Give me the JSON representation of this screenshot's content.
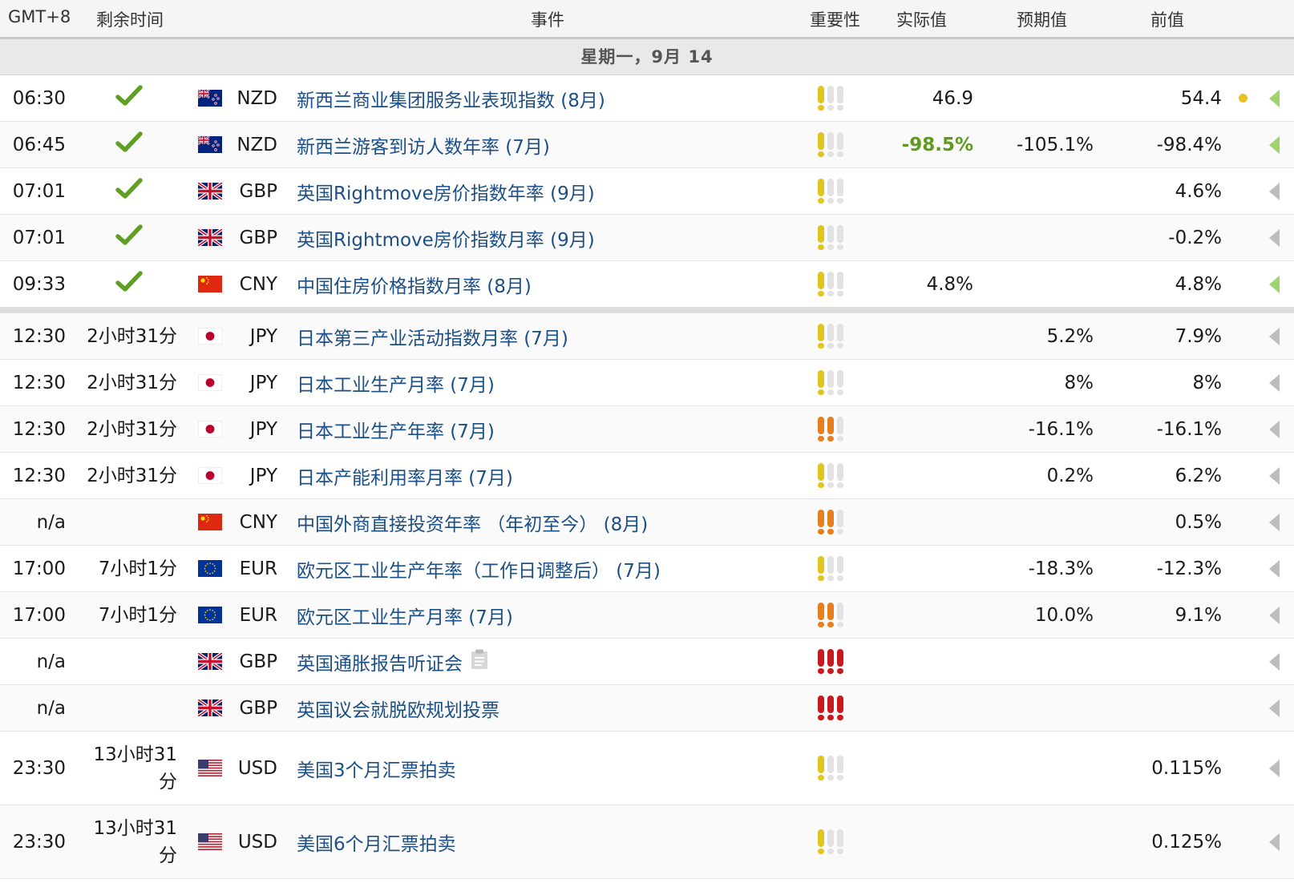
{
  "header": {
    "timezone": "GMT+8",
    "remaining": "剩余时间",
    "event": "事件",
    "importance": "重要性",
    "actual": "实际值",
    "forecast": "预期值",
    "previous": "前值"
  },
  "date_label": "星期一，9月 14",
  "colors": {
    "event_text": "#1c4f86",
    "actual_positive": "#5d9a1d",
    "check": "#5e9f24",
    "importance_low": "#e1c51c",
    "importance_medium": "#e87f1e",
    "importance_high": "#c8191f"
  },
  "rows": [
    {
      "time": "06:30",
      "done": true,
      "remaining": "",
      "flag": "nzd-flag",
      "currency": "NZD",
      "event": "新西兰商业集团服务业表现指数 (8月)",
      "importance": 1,
      "actual": "46.9",
      "actual_pos": false,
      "forecast": "",
      "previous": "54.4",
      "dot": true,
      "arrow": "green"
    },
    {
      "time": "06:45",
      "done": true,
      "remaining": "",
      "flag": "nzd-flag",
      "currency": "NZD",
      "event": "新西兰游客到访人数年率 (7月)",
      "importance": 1,
      "actual": "-98.5%",
      "actual_pos": true,
      "forecast": "-105.1%",
      "previous": "-98.4%",
      "dot": false,
      "arrow": "green"
    },
    {
      "time": "07:01",
      "done": true,
      "remaining": "",
      "flag": "gbp-flag",
      "currency": "GBP",
      "event": "英国Rightmove房价指数年率 (9月)",
      "importance": 1,
      "actual": "",
      "actual_pos": false,
      "forecast": "",
      "previous": "4.6%",
      "dot": false,
      "arrow": "gray"
    },
    {
      "time": "07:01",
      "done": true,
      "remaining": "",
      "flag": "gbp-flag",
      "currency": "GBP",
      "event": "英国Rightmove房价指数月率 (9月)",
      "importance": 1,
      "actual": "",
      "actual_pos": false,
      "forecast": "",
      "previous": "-0.2%",
      "dot": false,
      "arrow": "gray"
    },
    {
      "time": "09:33",
      "done": true,
      "remaining": "",
      "flag": "cny-flag",
      "currency": "CNY",
      "event": "中国住房价格指数月率 (8月)",
      "importance": 1,
      "actual": "4.8%",
      "actual_pos": false,
      "forecast": "",
      "previous": "4.8%",
      "dot": false,
      "arrow": "green",
      "separator": true
    },
    {
      "time": "12:30",
      "done": false,
      "remaining": "2小时31分",
      "flag": "jpy-flag",
      "currency": "JPY",
      "event": "日本第三产业活动指数月率 (7月)",
      "importance": 1,
      "actual": "",
      "actual_pos": false,
      "forecast": "5.2%",
      "previous": "7.9%",
      "dot": false,
      "arrow": "gray"
    },
    {
      "time": "12:30",
      "done": false,
      "remaining": "2小时31分",
      "flag": "jpy-flag",
      "currency": "JPY",
      "event": "日本工业生产月率 (7月)",
      "importance": 1,
      "actual": "",
      "actual_pos": false,
      "forecast": "8%",
      "previous": "8%",
      "dot": false,
      "arrow": "gray"
    },
    {
      "time": "12:30",
      "done": false,
      "remaining": "2小时31分",
      "flag": "jpy-flag",
      "currency": "JPY",
      "event": "日本工业生产年率 (7月)",
      "importance": 2,
      "actual": "",
      "actual_pos": false,
      "forecast": "-16.1%",
      "previous": "-16.1%",
      "dot": false,
      "arrow": "gray"
    },
    {
      "time": "12:30",
      "done": false,
      "remaining": "2小时31分",
      "flag": "jpy-flag",
      "currency": "JPY",
      "event": "日本产能利用率月率 (7月)",
      "importance": 1,
      "actual": "",
      "actual_pos": false,
      "forecast": "0.2%",
      "previous": "6.2%",
      "dot": false,
      "arrow": "gray"
    },
    {
      "time": "n/a",
      "done": false,
      "remaining": "",
      "flag": "cny-flag",
      "currency": "CNY",
      "event": "中国外商直接投资年率 （年初至今） (8月)",
      "importance": 2,
      "actual": "",
      "actual_pos": false,
      "forecast": "",
      "previous": "0.5%",
      "dot": false,
      "arrow": "gray"
    },
    {
      "time": "17:00",
      "done": false,
      "remaining": "7小时1分",
      "flag": "eur-flag",
      "currency": "EUR",
      "event": "欧元区工业生产年率（工作日调整后） (7月)",
      "importance": 1,
      "actual": "",
      "actual_pos": false,
      "forecast": "-18.3%",
      "previous": "-12.3%",
      "dot": false,
      "arrow": "gray"
    },
    {
      "time": "17:00",
      "done": false,
      "remaining": "7小时1分",
      "flag": "eur-flag",
      "currency": "EUR",
      "event": "欧元区工业生产月率 (7月)",
      "importance": 2,
      "actual": "",
      "actual_pos": false,
      "forecast": "10.0%",
      "previous": "9.1%",
      "dot": false,
      "arrow": "gray"
    },
    {
      "time": "n/a",
      "done": false,
      "remaining": "",
      "flag": "gbp-flag",
      "currency": "GBP",
      "event": "英国通胀报告听证会",
      "importance": 3,
      "actual": "",
      "actual_pos": false,
      "forecast": "",
      "previous": "",
      "dot": false,
      "arrow": "gray",
      "doc_icon": "document-icon"
    },
    {
      "time": "n/a",
      "done": false,
      "remaining": "",
      "flag": "gbp-flag",
      "currency": "GBP",
      "event": "英国议会就脱欧规划投票",
      "importance": 3,
      "actual": "",
      "actual_pos": false,
      "forecast": "",
      "previous": "",
      "dot": false,
      "arrow": "gray"
    },
    {
      "time": "23:30",
      "done": false,
      "remaining": "13小时31分",
      "flag": "usd-flag",
      "currency": "USD",
      "event": "美国3个月汇票拍卖",
      "importance": 1,
      "actual": "",
      "actual_pos": false,
      "forecast": "",
      "previous": "0.115%",
      "dot": false,
      "arrow": "gray",
      "tall": true
    },
    {
      "time": "23:30",
      "done": false,
      "remaining": "13小时31分",
      "flag": "usd-flag",
      "currency": "USD",
      "event": "美国6个月汇票拍卖",
      "importance": 1,
      "actual": "",
      "actual_pos": false,
      "forecast": "",
      "previous": "0.125%",
      "dot": false,
      "arrow": "gray",
      "tall": true
    }
  ]
}
